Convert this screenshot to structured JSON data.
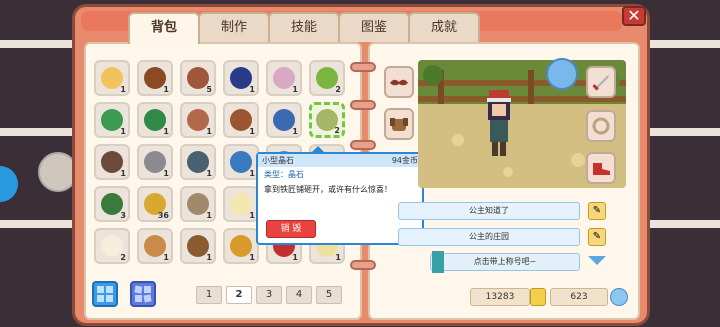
{
  "tabs": [
    "背包",
    "制作",
    "技能",
    "图鉴",
    "成就"
  ],
  "close_label": "✕",
  "inventory": [
    {
      "icon": "bread-icon",
      "color": "#f2c35a",
      "count": "1"
    },
    {
      "icon": "chestnut-icon",
      "color": "#8b4a24",
      "count": "1"
    },
    {
      "icon": "pinecone-icon",
      "color": "#a0563a",
      "count": "5"
    },
    {
      "icon": "sea-urchin-icon",
      "color": "#2a3a8a",
      "count": "1"
    },
    {
      "icon": "shell-icon",
      "color": "#d9a8c4",
      "count": "1"
    },
    {
      "icon": "leaf-icon",
      "color": "#79b540",
      "count": "2"
    },
    {
      "icon": "seaweed-icon",
      "color": "#3a9a50",
      "count": "1"
    },
    {
      "icon": "moss-icon",
      "color": "#2f8a4a",
      "count": "1"
    },
    {
      "icon": "pinecone-icon",
      "color": "#b06a4a",
      "count": "1"
    },
    {
      "icon": "branch-icon",
      "color": "#9b5530",
      "count": "1"
    },
    {
      "icon": "log-icon",
      "color": "#3a6ab0",
      "count": "1"
    },
    {
      "icon": "crystal-icon",
      "color": "#a6b56a",
      "count": "2"
    },
    {
      "icon": "helmet-icon",
      "color": "#6a4a3a",
      "count": "1"
    },
    {
      "icon": "stone-icon",
      "color": "#8a8a90",
      "count": "1"
    },
    {
      "icon": "axe-icon",
      "color": "#4a6070",
      "count": "1"
    },
    {
      "icon": "pickaxe-icon",
      "color": "#3a7ac0",
      "count": "1"
    },
    {
      "icon": "wool-icon",
      "color": "#4a8ac0",
      "count": "1"
    },
    {
      "icon": "",
      "color": "",
      "count": ""
    },
    {
      "icon": "vine-icon",
      "color": "#3a7a3a",
      "count": "3"
    },
    {
      "icon": "wheat-icon",
      "color": "#d8a830",
      "count": "36"
    },
    {
      "icon": "ore-icon",
      "color": "#a08a6a",
      "count": "1"
    },
    {
      "icon": "egg-icon",
      "color": "#f4e6b0",
      "count": "1"
    },
    {
      "icon": "",
      "color": "",
      "count": ""
    },
    {
      "icon": "",
      "color": "",
      "count": ""
    },
    {
      "icon": "egg-icon",
      "color": "#f6eedc",
      "count": "2"
    },
    {
      "icon": "potato-icon",
      "color": "#c98a4a",
      "count": "1"
    },
    {
      "icon": "seed-icon",
      "color": "#8a5a30",
      "count": "1"
    },
    {
      "icon": "honey-jar-icon",
      "color": "#d89a2a",
      "count": "1"
    },
    {
      "icon": "berry-icon",
      "color": "#c03030",
      "count": "1"
    },
    {
      "icon": "cheese-icon",
      "color": "#f0e0a0",
      "count": "1"
    }
  ],
  "tooltip": {
    "name": "小型晶石",
    "price": "94金币",
    "type": "类型：晶石",
    "desc": "拿到铁匠铺砸开，或许有什么惊喜！",
    "sell": "销 毁"
  },
  "pagination": [
    "1",
    "2",
    "3",
    "4",
    "5"
  ],
  "active_page": "2",
  "profile": {
    "title1": "公主知道了",
    "title2": "公主的庄园",
    "banner": "点击带上称号吧~"
  },
  "currency": {
    "gold": "13283",
    "gems": "623"
  },
  "colors": {
    "frame": "#e88a6c",
    "page": "#fff7ec",
    "tooltip_border": "#2c86d6",
    "sell_button": "#e8433f"
  }
}
